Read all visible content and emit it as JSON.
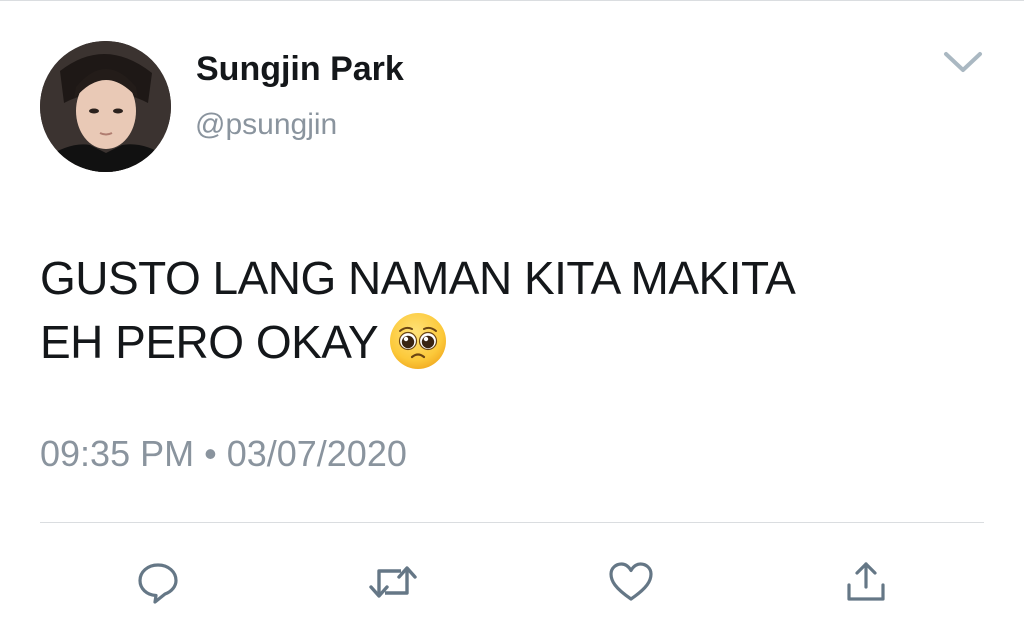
{
  "tweet": {
    "author": {
      "display_name": "Sungjin Park",
      "handle": "@psungjin"
    },
    "text_lines": [
      "GUSTO LANG NAMAN KITA MAKITA",
      "EH PERO OKAY"
    ],
    "emoji": "pleading-face",
    "timestamp": "09:35 PM • 03/07/2020"
  },
  "actions": [
    "reply",
    "retweet",
    "like",
    "share"
  ],
  "icons": {
    "menu": "chevron-down-icon",
    "reply": "reply-icon",
    "retweet": "retweet-icon",
    "like": "heart-icon",
    "share": "share-icon"
  },
  "colors": {
    "text": "#14171a",
    "secondary_text": "#8a949e",
    "icon": "#657786",
    "divider": "#dadde0",
    "background": "#ffffff"
  }
}
